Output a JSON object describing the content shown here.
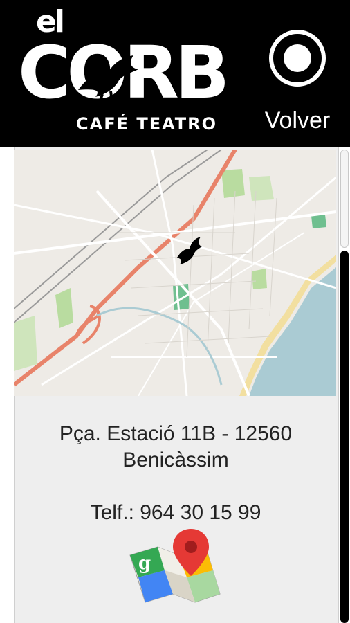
{
  "header": {
    "logo_prefix": "el",
    "logo_name": "CORB",
    "logo_subtitle": "CAFÉ TEATRO",
    "back_button_label": "Volver"
  },
  "map": {
    "icon": "crow-location-marker",
    "colors": {
      "land": "#eeebe6",
      "sea": "#aacbd3",
      "beach": "#f2dfa0",
      "motorway": "#e8836a",
      "park": "#b9dca0"
    }
  },
  "contact": {
    "address_line1": "Pça. Estació 11B - 12560",
    "address_line2": "Benicàssim",
    "phone": "Telf.: 964 30 15 99"
  },
  "actions": {
    "maps_icon": "google-maps-icon"
  }
}
